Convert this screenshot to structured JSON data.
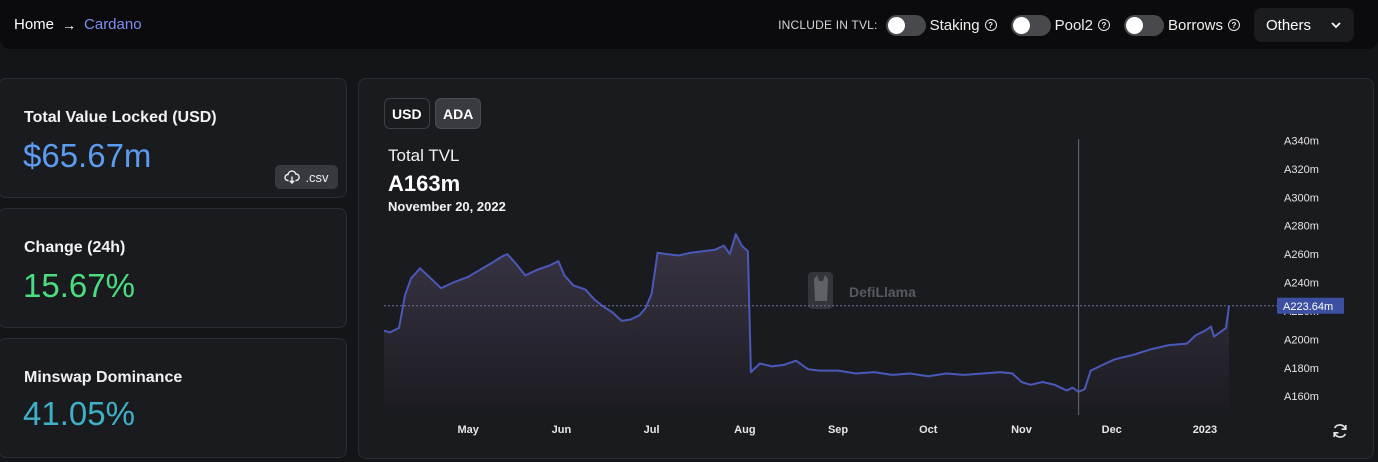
{
  "breadcrumb": {
    "home": "Home",
    "current": "Cardano"
  },
  "tvl_options": {
    "label": "INCLUDE IN TVL:",
    "toggles": [
      {
        "label": "Staking",
        "on": false
      },
      {
        "label": "Pool2",
        "on": false
      },
      {
        "label": "Borrows",
        "on": false
      }
    ],
    "others_label": "Others"
  },
  "stats": {
    "tvl_label": "Total Value Locked (USD)",
    "tvl_value": "$65.67m",
    "csv_label": ".csv",
    "change_label": "Change (24h)",
    "change_value": "15.67%",
    "dominance_label": "Minswap Dominance",
    "dominance_value": "41.05%"
  },
  "colors": {
    "tvl_value": "#5b9bf0",
    "change_value": "#4ade80",
    "dominance_value": "#3eb1c7",
    "line": "#4a58b8",
    "area_top": "#3a3545",
    "area_bottom": "#1c1c22",
    "price_tag": "#3d4fa3"
  },
  "currency_buttons": [
    "USD",
    "ADA"
  ],
  "active_currency": "ADA",
  "tooltip": {
    "title": "Total TVL",
    "value": "A163m",
    "date": "November 20, 2022"
  },
  "watermark": "DefiLlama",
  "chart_data": {
    "type": "area",
    "x_ticks": [
      "May",
      "Jun",
      "Jul",
      "Aug",
      "Sep",
      "Oct",
      "Nov",
      "Dec",
      "2023"
    ],
    "y_ticks": [
      "A160m",
      "A180m",
      "A200m",
      "A220m",
      "A240m",
      "A260m",
      "A280m",
      "A300m",
      "A320m",
      "A340m"
    ],
    "y_tick_values": [
      160,
      180,
      200,
      220,
      240,
      260,
      280,
      300,
      320,
      340
    ],
    "ylim": [
      151,
      341
    ],
    "current_value_label": "A223.64m",
    "current_value": 223.64,
    "hover_date": "2022-11-20",
    "series": [
      {
        "values": [
          [
            "2022-04-03",
            206
          ],
          [
            "2022-04-05",
            205
          ],
          [
            "2022-04-08",
            208
          ],
          [
            "2022-04-10",
            231
          ],
          [
            "2022-04-12",
            243
          ],
          [
            "2022-04-15",
            250
          ],
          [
            "2022-04-18",
            244
          ],
          [
            "2022-04-22",
            236
          ],
          [
            "2022-04-26",
            240
          ],
          [
            "2022-05-01",
            244
          ],
          [
            "2022-05-05",
            249
          ],
          [
            "2022-05-09",
            254
          ],
          [
            "2022-05-12",
            258
          ],
          [
            "2022-05-14",
            260
          ],
          [
            "2022-05-17",
            253
          ],
          [
            "2022-05-20",
            245
          ],
          [
            "2022-05-24",
            249
          ],
          [
            "2022-05-28",
            252
          ],
          [
            "2022-05-31",
            255
          ],
          [
            "2022-06-02",
            245
          ],
          [
            "2022-06-05",
            238
          ],
          [
            "2022-06-09",
            235
          ],
          [
            "2022-06-12",
            228
          ],
          [
            "2022-06-15",
            223
          ],
          [
            "2022-06-18",
            219
          ],
          [
            "2022-06-21",
            213
          ],
          [
            "2022-06-24",
            214
          ],
          [
            "2022-06-27",
            217
          ],
          [
            "2022-06-29",
            222
          ],
          [
            "2022-07-01",
            232
          ],
          [
            "2022-07-03",
            261
          ],
          [
            "2022-07-06",
            260
          ],
          [
            "2022-07-10",
            259
          ],
          [
            "2022-07-14",
            261
          ],
          [
            "2022-07-18",
            262
          ],
          [
            "2022-07-22",
            263
          ],
          [
            "2022-07-25",
            266
          ],
          [
            "2022-07-27",
            260
          ],
          [
            "2022-07-29",
            274
          ],
          [
            "2022-07-31",
            266
          ],
          [
            "2022-08-02",
            262
          ],
          [
            "2022-08-03",
            177
          ],
          [
            "2022-08-06",
            183
          ],
          [
            "2022-08-10",
            181
          ],
          [
            "2022-08-14",
            182
          ],
          [
            "2022-08-18",
            185
          ],
          [
            "2022-08-22",
            179
          ],
          [
            "2022-08-26",
            178
          ],
          [
            "2022-09-01",
            178
          ],
          [
            "2022-09-07",
            176
          ],
          [
            "2022-09-13",
            177
          ],
          [
            "2022-09-19",
            175
          ],
          [
            "2022-09-25",
            176
          ],
          [
            "2022-10-01",
            174
          ],
          [
            "2022-10-07",
            176
          ],
          [
            "2022-10-13",
            175
          ],
          [
            "2022-10-19",
            176
          ],
          [
            "2022-10-25",
            177
          ],
          [
            "2022-10-29",
            176
          ],
          [
            "2022-11-01",
            170
          ],
          [
            "2022-11-04",
            168
          ],
          [
            "2022-11-08",
            170
          ],
          [
            "2022-11-12",
            168
          ],
          [
            "2022-11-16",
            164
          ],
          [
            "2022-11-18",
            166
          ],
          [
            "2022-11-20",
            163
          ],
          [
            "2022-11-22",
            165
          ],
          [
            "2022-11-24",
            178
          ],
          [
            "2022-11-28",
            182
          ],
          [
            "2022-12-02",
            186
          ],
          [
            "2022-12-08",
            189
          ],
          [
            "2022-12-14",
            193
          ],
          [
            "2022-12-20",
            196
          ],
          [
            "2022-12-26",
            197
          ],
          [
            "2022-12-29",
            203
          ],
          [
            "2023-01-01",
            206
          ],
          [
            "2023-01-03",
            209
          ],
          [
            "2023-01-04",
            202
          ],
          [
            "2023-01-06",
            205
          ],
          [
            "2023-01-08",
            208
          ],
          [
            "2023-01-09",
            223.64
          ]
        ]
      }
    ]
  }
}
